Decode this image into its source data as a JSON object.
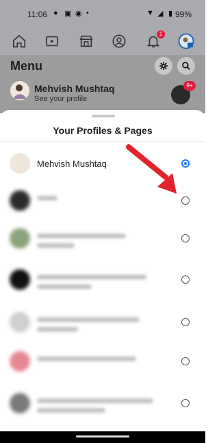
{
  "status_bar": {
    "time": "11:06",
    "battery": "99%",
    "icons": [
      "messenger-icon",
      "news-icon",
      "spotify-icon",
      "dot-icon",
      "wifi-icon",
      "signal-icon",
      "battery-icon"
    ]
  },
  "nav": {
    "items": [
      {
        "name": "home",
        "icon": "home-icon"
      },
      {
        "name": "watch",
        "icon": "video-icon"
      },
      {
        "name": "marketplace",
        "icon": "store-icon"
      },
      {
        "name": "profile",
        "icon": "profile-icon"
      },
      {
        "name": "notifications",
        "icon": "bell-icon",
        "badge": "1"
      },
      {
        "name": "menu",
        "icon": "menu-avatar-icon"
      }
    ],
    "active": "menu"
  },
  "menu": {
    "title": "Menu",
    "profile_name": "Mehvish Mushtaq",
    "profile_subtitle": "See your profile",
    "mini_badge": "9+"
  },
  "sheet": {
    "title": "Your Profiles & Pages",
    "rows": [
      {
        "name": "Mehvish Mushtaq",
        "selected": true,
        "avatar_color": "#efe6dc"
      },
      {
        "name": "",
        "selected": false,
        "avatar_color": "#2b2b2b"
      },
      {
        "name": "",
        "selected": false,
        "avatar_color": "#8aa37a"
      },
      {
        "name": "",
        "selected": false,
        "avatar_color": "#111111"
      },
      {
        "name": "",
        "selected": false,
        "avatar_color": "#cfcfcf"
      },
      {
        "name": "",
        "selected": false,
        "avatar_color": "#e58a94"
      },
      {
        "name": "",
        "selected": false,
        "avatar_color": "#7a7a7a"
      }
    ]
  },
  "colors": {
    "accent": "#1877f2",
    "arrow": "#e0242c",
    "badge": "#e41e3f"
  }
}
